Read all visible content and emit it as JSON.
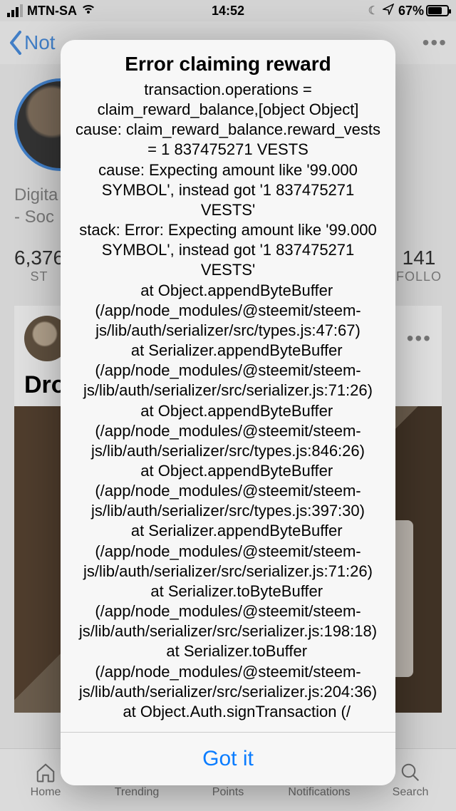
{
  "status": {
    "carrier": "MTN-SA",
    "time": "14:52",
    "battery_pct": "67%"
  },
  "nav": {
    "back_label": "Not",
    "more_glyph": "•••"
  },
  "profile": {
    "bio_line1": "Digita",
    "bio_line2": "- Soc",
    "stat1_value": "6,376",
    "stat1_label": "ST",
    "stat2_value": "141",
    "stat2_label": "FOLLO"
  },
  "post": {
    "title": "Drop",
    "more_glyph": "•••"
  },
  "tabs": {
    "home": "Home",
    "trending": "Trending",
    "points": "Points",
    "notifications": "Notifications",
    "search": "Search"
  },
  "modal": {
    "title": "Error claiming reward",
    "body": "transaction.operations = claim_reward_balance,[object Object]\ncause: claim_reward_balance.reward_vests = 1 837475271 VESTS\ncause: Expecting amount like '99.000 SYMBOL', instead got '1 837475271 VESTS'\nstack: Error: Expecting amount like '99.000 SYMBOL', instead got '1 837475271 VESTS'\n    at Object.appendByteBuffer (/app/node_modules/@steemit/steem-js/lib/auth/serializer/src/types.js:47:67)\n    at Serializer.appendByteBuffer (/app/node_modules/@steemit/steem-js/lib/auth/serializer/src/serializer.js:71:26)\n    at Object.appendByteBuffer (/app/node_modules/@steemit/steem-js/lib/auth/serializer/src/types.js:846:26)\n    at Object.appendByteBuffer (/app/node_modules/@steemit/steem-js/lib/auth/serializer/src/types.js:397:30)\n    at Serializer.appendByteBuffer (/app/node_modules/@steemit/steem-js/lib/auth/serializer/src/serializer.js:71:26)\n    at Serializer.toByteBuffer (/app/node_modules/@steemit/steem-js/lib/auth/serializer/src/serializer.js:198:18)\n    at Serializer.toBuffer (/app/node_modules/@steemit/steem-js/lib/auth/serializer/src/serializer.js:204:36)\n    at Object.Auth.signTransaction (/",
    "button": "Got it"
  }
}
